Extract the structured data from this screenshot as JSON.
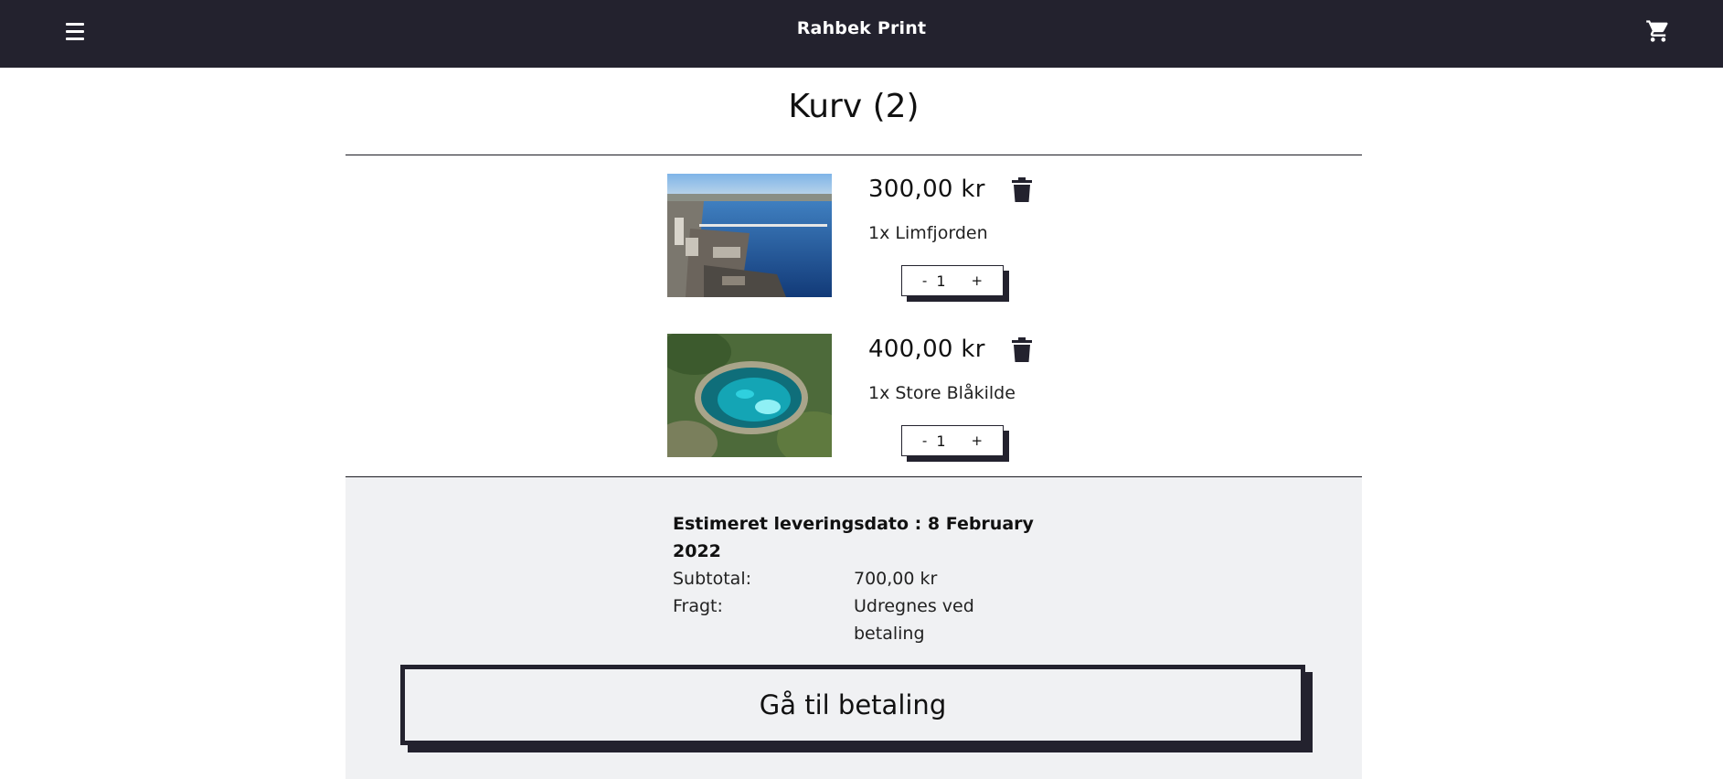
{
  "header": {
    "brand": "Rahbek Print",
    "menu_icon": "hamburger-menu-icon",
    "cart_icon": "shopping-cart-icon",
    "background_color": "#23222e"
  },
  "cart": {
    "title": "Kurv (2)",
    "items": [
      {
        "price": "300,00 kr",
        "description": "1x Limfjorden",
        "quantity_minus": "-",
        "quantity": "1",
        "quantity_plus": "+",
        "image": "aerial photo of Limfjorden with bridge",
        "delete_icon": "trash-icon"
      },
      {
        "price": "400,00 kr",
        "description": "1x Store Blåkilde",
        "quantity_minus": "-",
        "quantity": "1",
        "quantity_plus": "+",
        "image": "aerial photo of blue spring Store Blåkilde",
        "delete_icon": "trash-icon"
      }
    ]
  },
  "summary": {
    "delivery_label": "Estimeret leveringsdato : 8 February 2022",
    "subtotal_label": "Subtotal:",
    "subtotal_value": "700,00 kr",
    "shipping_label": "Fragt:",
    "shipping_value": "Udregnes ved betaling",
    "checkout_label": "Gå til betaling",
    "background_color": "#f0f1f3"
  }
}
